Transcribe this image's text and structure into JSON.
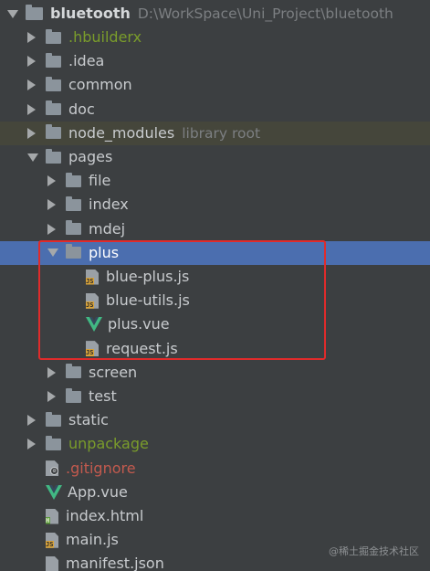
{
  "tree": {
    "root": {
      "name": "bluetooth",
      "path": "D:\\WorkSpace\\Uni_Project\\bluetooth"
    },
    "items": [
      {
        "label": ".hbuilderx",
        "kind": "folder",
        "state": "collapsed",
        "depth": 1,
        "color": "green"
      },
      {
        "label": ".idea",
        "kind": "folder",
        "state": "collapsed",
        "depth": 1
      },
      {
        "label": "common",
        "kind": "folder",
        "state": "collapsed",
        "depth": 1
      },
      {
        "label": "doc",
        "kind": "folder",
        "state": "collapsed",
        "depth": 1
      },
      {
        "label": "node_modules",
        "kind": "folder",
        "state": "collapsed",
        "depth": 1,
        "suffix": "library root"
      },
      {
        "label": "pages",
        "kind": "folder",
        "state": "expanded",
        "depth": 1
      },
      {
        "label": "file",
        "kind": "folder",
        "state": "collapsed",
        "depth": 2
      },
      {
        "label": "index",
        "kind": "folder",
        "state": "collapsed",
        "depth": 2
      },
      {
        "label": "mdej",
        "kind": "folder",
        "state": "collapsed",
        "depth": 2
      },
      {
        "label": "plus",
        "kind": "folder",
        "state": "expanded",
        "depth": 2,
        "selected": true
      },
      {
        "label": "blue-plus.js",
        "kind": "js",
        "depth": 3
      },
      {
        "label": "blue-utils.js",
        "kind": "js",
        "depth": 3
      },
      {
        "label": "plus.vue",
        "kind": "vue",
        "depth": 3
      },
      {
        "label": "request.js",
        "kind": "js",
        "depth": 3
      },
      {
        "label": "screen",
        "kind": "folder",
        "state": "collapsed",
        "depth": 2
      },
      {
        "label": "test",
        "kind": "folder",
        "state": "collapsed",
        "depth": 2
      },
      {
        "label": "static",
        "kind": "folder",
        "state": "collapsed",
        "depth": 1
      },
      {
        "label": "unpackage",
        "kind": "folder",
        "state": "collapsed",
        "depth": 1,
        "color": "green"
      },
      {
        "label": ".gitignore",
        "kind": "ignore",
        "depth": 1,
        "color": "red"
      },
      {
        "label": "App.vue",
        "kind": "vue",
        "depth": 1
      },
      {
        "label": "index.html",
        "kind": "html",
        "depth": 1
      },
      {
        "label": "main.js",
        "kind": "js",
        "depth": 1
      },
      {
        "label": "manifest.json",
        "kind": "json",
        "depth": 1
      }
    ]
  },
  "watermark": "@稀土掘金技术社区",
  "colors": {
    "background": "#3c3f41",
    "selection": "#4b6eaf",
    "highlight_border": "#e02b2b",
    "vue_green": "#41b883",
    "js_badge": "#d8a33a"
  }
}
